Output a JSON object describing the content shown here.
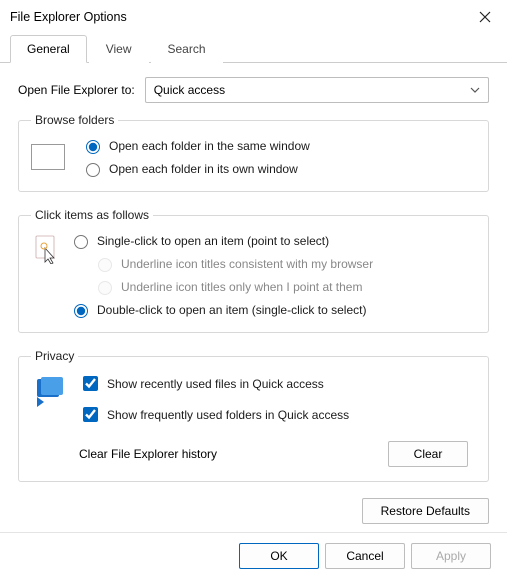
{
  "title": "File Explorer Options",
  "tabs": {
    "general": "General",
    "view": "View",
    "search": "Search"
  },
  "open_to": {
    "label": "Open File Explorer to:",
    "value": "Quick access"
  },
  "browse": {
    "legend": "Browse folders",
    "same": "Open each folder in the same window",
    "own": "Open each folder in its own window"
  },
  "click": {
    "legend": "Click items as follows",
    "single": "Single-click to open an item (point to select)",
    "underline_browser": "Underline icon titles consistent with my browser",
    "underline_point": "Underline icon titles only when I point at them",
    "double": "Double-click to open an item (single-click to select)"
  },
  "privacy": {
    "legend": "Privacy",
    "recent": "Show recently used files in Quick access",
    "frequent": "Show frequently used folders in Quick access",
    "clear_label": "Clear File Explorer history",
    "clear_btn": "Clear"
  },
  "restore": "Restore Defaults",
  "footer": {
    "ok": "OK",
    "cancel": "Cancel",
    "apply": "Apply"
  }
}
